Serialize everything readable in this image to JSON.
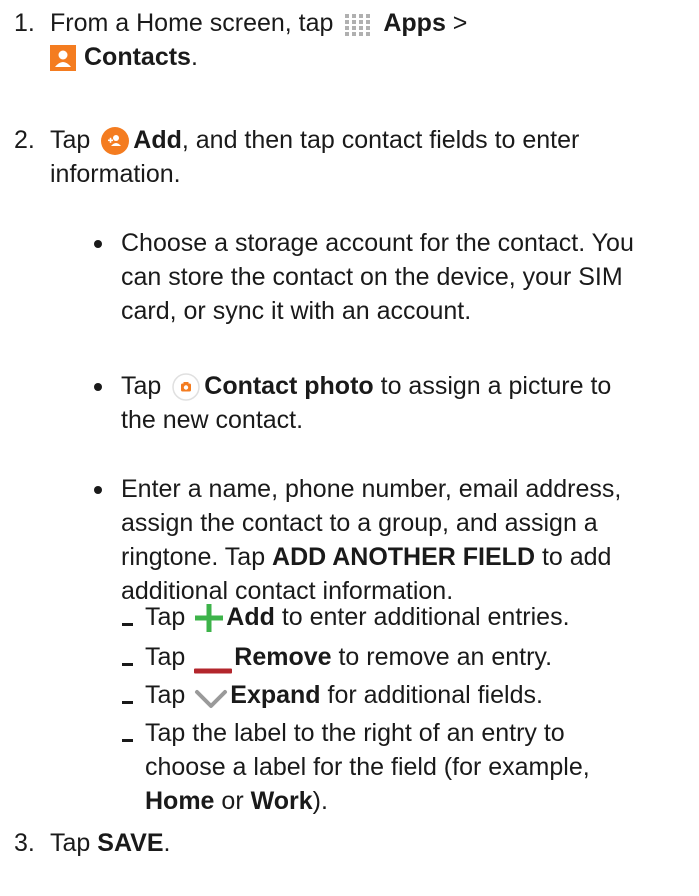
{
  "steps": [
    {
      "num": "1.",
      "pre": "From a Home screen, tap",
      "apps": "Apps",
      "gt": ">",
      "contacts": "Contacts",
      "end": "."
    },
    {
      "num": "2.",
      "pre": "Tap",
      "add": "Add",
      "post": ", and then tap contact fields to enter",
      "line2": "information."
    },
    {
      "num": "3.",
      "pre": "Tap",
      "save": "SAVE",
      "end": "."
    }
  ],
  "bullets": [
    {
      "lines": [
        "Choose a storage account for the contact. You",
        "can store the contact on the device, your SIM",
        "card, or sync it with an account."
      ]
    },
    {
      "pre": "Tap",
      "bold": "Contact photo",
      "post": "to assign a picture to",
      "line2": "the new contact."
    },
    {
      "line1": "Enter a name, phone number, email address,",
      "line2": "assign the contact to a group, and assign a",
      "line3_pre": "ringtone. Tap",
      "line3_bold": "ADD ANOTHER FIELD",
      "line3_post": "to add",
      "line4": "additional contact information."
    }
  ],
  "subitems": [
    {
      "pre": "Tap",
      "bold": "Add",
      "post": "to enter additional entries."
    },
    {
      "pre": "Tap",
      "bold": "Remove",
      "post": "to remove an entry."
    },
    {
      "pre": "Tap",
      "bold": "Expand",
      "post": "for additional fields."
    },
    {
      "line1": "Tap the label to the right of an entry to",
      "line2": "choose a label for the field (for example,",
      "line3_b1": "Home",
      "line3_mid": "or",
      "line3_b2": "Work",
      "line3_end": ")."
    }
  ],
  "icons": {
    "apps": "grid-icon",
    "contacts": "contacts-app-icon",
    "add": "add-contact-icon",
    "photo": "camera-icon",
    "plus": "plus-icon",
    "minus": "minus-icon",
    "expand": "chevron-down-icon"
  },
  "colors": {
    "orange": "#f47c20",
    "green": "#3db34a",
    "red": "#b3262c",
    "gray": "#9a9a9a"
  }
}
